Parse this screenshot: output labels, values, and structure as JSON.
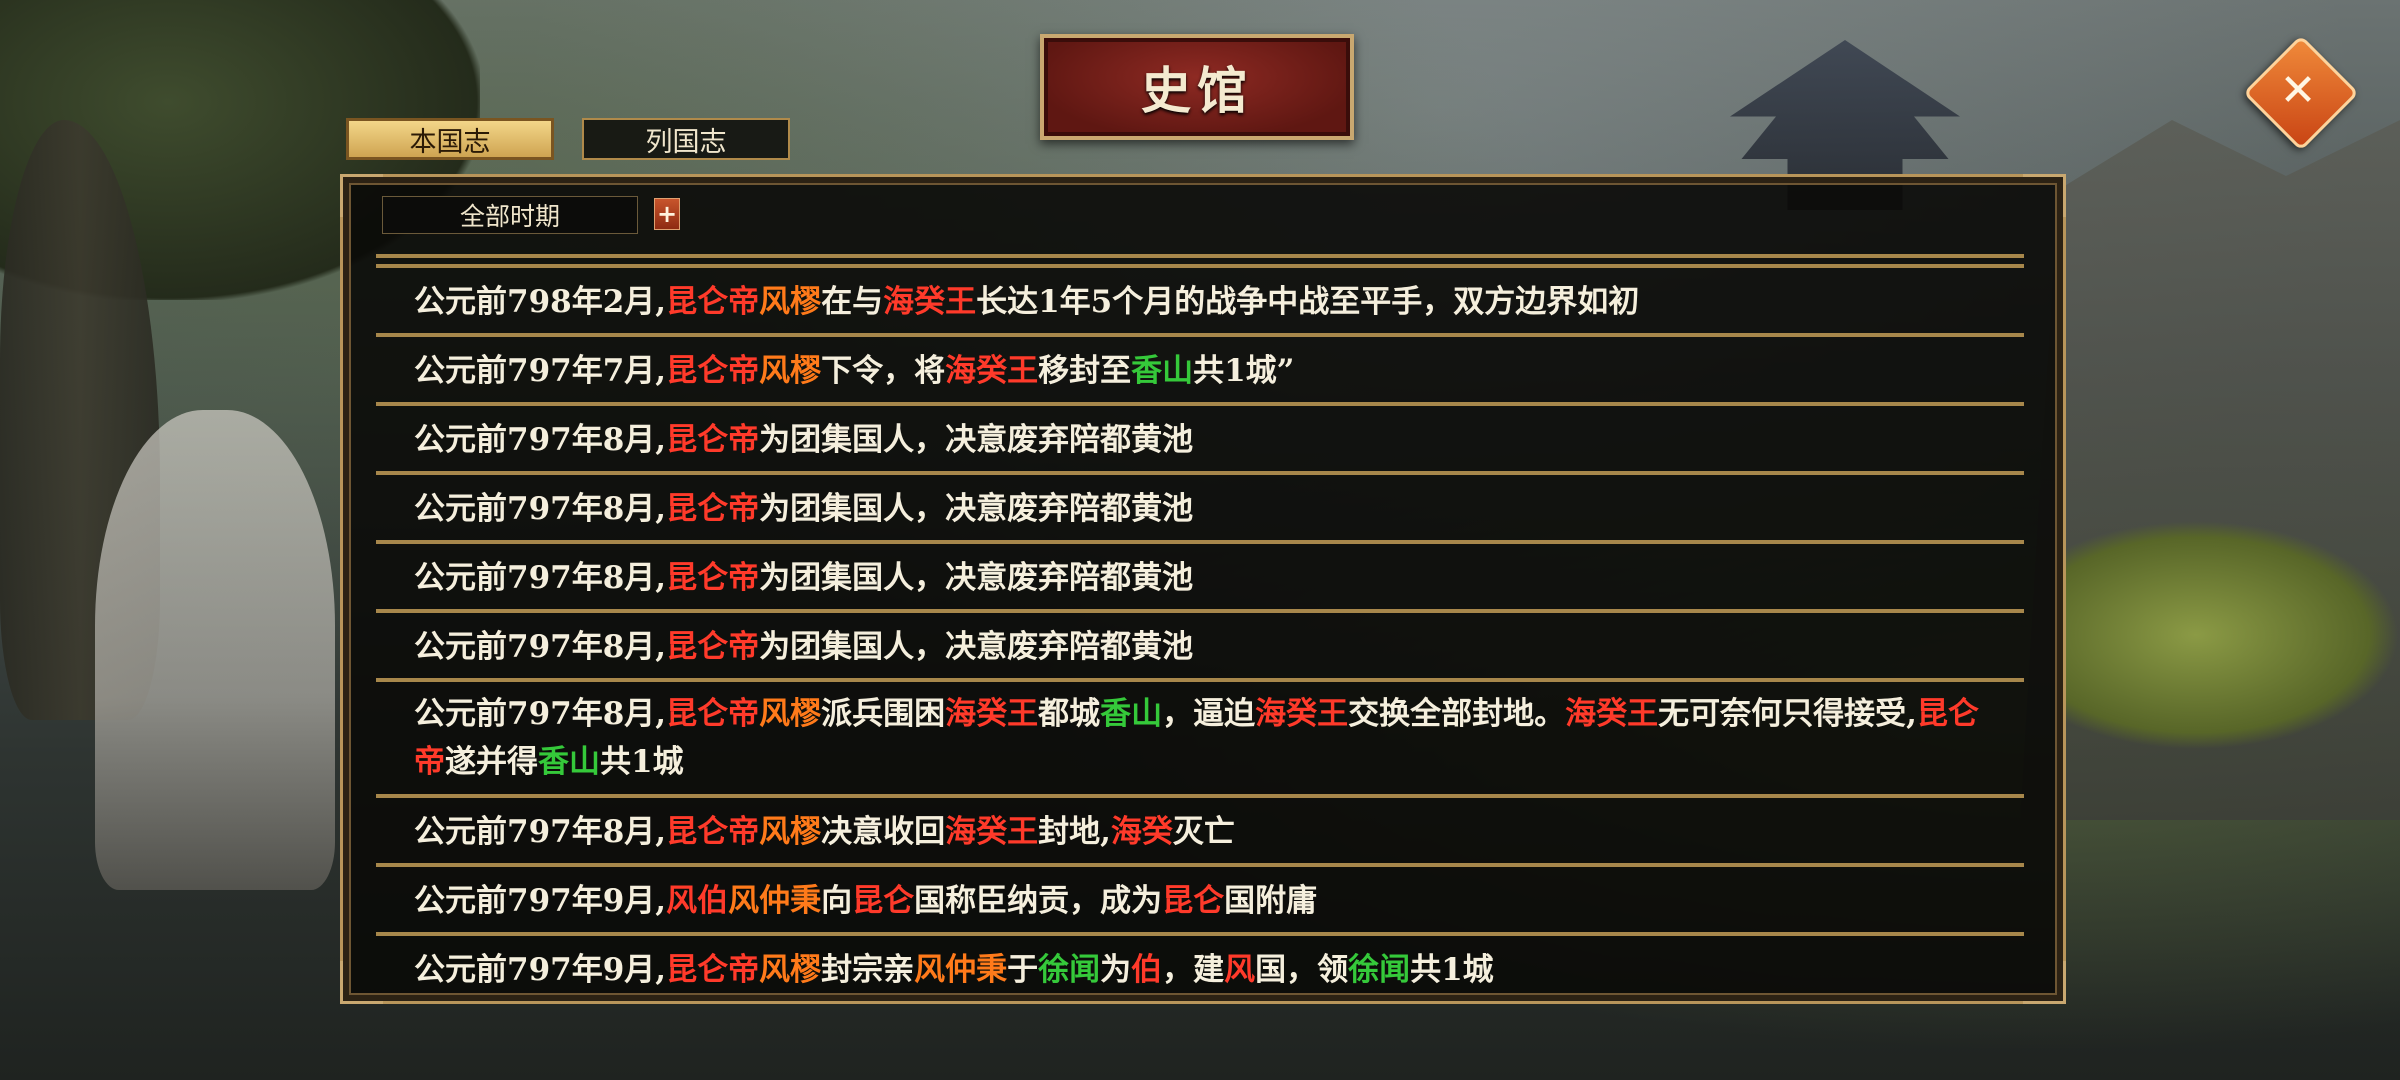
{
  "title": "史馆",
  "tabs": [
    {
      "label": "本国志",
      "active": true
    },
    {
      "label": "列国志",
      "active": false
    }
  ],
  "filter": {
    "label": "全部时期",
    "expand_icon": "plus"
  },
  "close_icon": "close-x",
  "colors": {
    "text": "#f5efdd",
    "highlight_red": "#ff3a2a",
    "highlight_orange": "#ff7a1a",
    "highlight_green": "#35c93a",
    "accent_gold": "#b8955a"
  },
  "entries": [
    {
      "segments": [
        {
          "t": "公元前798年2月,",
          "c": ""
        },
        {
          "t": "昆仑帝",
          "c": "r"
        },
        {
          "t": "风樛",
          "c": "o"
        },
        {
          "t": "在与",
          "c": ""
        },
        {
          "t": "海癸王",
          "c": "r"
        },
        {
          "t": "长达1年5个月的战争中战至平手，双方边界如初",
          "c": ""
        }
      ]
    },
    {
      "segments": [
        {
          "t": "公元前797年7月,",
          "c": ""
        },
        {
          "t": "昆仑帝",
          "c": "r"
        },
        {
          "t": "风樛",
          "c": "o"
        },
        {
          "t": "下令，将",
          "c": ""
        },
        {
          "t": "海癸王",
          "c": "r"
        },
        {
          "t": "移封至",
          "c": ""
        },
        {
          "t": "香山",
          "c": "g"
        },
        {
          "t": "共1城”",
          "c": ""
        }
      ]
    },
    {
      "segments": [
        {
          "t": "公元前797年8月,",
          "c": ""
        },
        {
          "t": "昆仑帝",
          "c": "r"
        },
        {
          "t": "为团集国人，决意废弃陪都黄池",
          "c": ""
        }
      ]
    },
    {
      "segments": [
        {
          "t": "公元前797年8月,",
          "c": ""
        },
        {
          "t": "昆仑帝",
          "c": "r"
        },
        {
          "t": "为团集国人，决意废弃陪都黄池",
          "c": ""
        }
      ]
    },
    {
      "segments": [
        {
          "t": "公元前797年8月,",
          "c": ""
        },
        {
          "t": "昆仑帝",
          "c": "r"
        },
        {
          "t": "为团集国人，决意废弃陪都黄池",
          "c": ""
        }
      ]
    },
    {
      "segments": [
        {
          "t": "公元前797年8月,",
          "c": ""
        },
        {
          "t": "昆仑帝",
          "c": "r"
        },
        {
          "t": "为团集国人，决意废弃陪都黄池",
          "c": ""
        }
      ]
    },
    {
      "multiline": true,
      "segments": [
        {
          "t": "公元前797年8月,",
          "c": ""
        },
        {
          "t": "昆仑帝",
          "c": "r"
        },
        {
          "t": "风樛",
          "c": "o"
        },
        {
          "t": "派兵围困",
          "c": ""
        },
        {
          "t": "海癸王",
          "c": "r"
        },
        {
          "t": "都城",
          "c": ""
        },
        {
          "t": "香山",
          "c": "g"
        },
        {
          "t": "，逼迫",
          "c": ""
        },
        {
          "t": "海癸王",
          "c": "r"
        },
        {
          "t": "交换全部封地。",
          "c": ""
        },
        {
          "t": "海癸王",
          "c": "r"
        },
        {
          "t": "无可奈何只得接受,",
          "c": ""
        },
        {
          "t": "昆仑帝",
          "c": "r"
        },
        {
          "t": "遂并得",
          "c": ""
        },
        {
          "t": "香山",
          "c": "g"
        },
        {
          "t": "共1城",
          "c": ""
        }
      ]
    },
    {
      "segments": [
        {
          "t": "公元前797年8月,",
          "c": ""
        },
        {
          "t": "昆仑帝",
          "c": "r"
        },
        {
          "t": "风樛",
          "c": "o"
        },
        {
          "t": "决意收回",
          "c": ""
        },
        {
          "t": "海癸王",
          "c": "r"
        },
        {
          "t": "封地,",
          "c": ""
        },
        {
          "t": "海癸",
          "c": "r"
        },
        {
          "t": "灭亡",
          "c": ""
        }
      ]
    },
    {
      "segments": [
        {
          "t": "公元前797年9月,",
          "c": ""
        },
        {
          "t": "风伯",
          "c": "r"
        },
        {
          "t": "风仲秉",
          "c": "o"
        },
        {
          "t": "向",
          "c": ""
        },
        {
          "t": "昆仑",
          "c": "r"
        },
        {
          "t": "国称臣纳贡，成为",
          "c": ""
        },
        {
          "t": "昆仑",
          "c": "r"
        },
        {
          "t": "国附庸",
          "c": ""
        }
      ]
    },
    {
      "segments": [
        {
          "t": "公元前797年9月,",
          "c": ""
        },
        {
          "t": "昆仑帝",
          "c": "r"
        },
        {
          "t": "风樛",
          "c": "o"
        },
        {
          "t": "封宗亲",
          "c": ""
        },
        {
          "t": "风仲秉",
          "c": "o"
        },
        {
          "t": "于",
          "c": ""
        },
        {
          "t": "徐闻",
          "c": "g"
        },
        {
          "t": "为",
          "c": ""
        },
        {
          "t": "伯",
          "c": "r"
        },
        {
          "t": "，建",
          "c": ""
        },
        {
          "t": "风",
          "c": "r"
        },
        {
          "t": "国，领",
          "c": ""
        },
        {
          "t": "徐闻",
          "c": "g"
        },
        {
          "t": "共1城",
          "c": ""
        }
      ]
    }
  ]
}
